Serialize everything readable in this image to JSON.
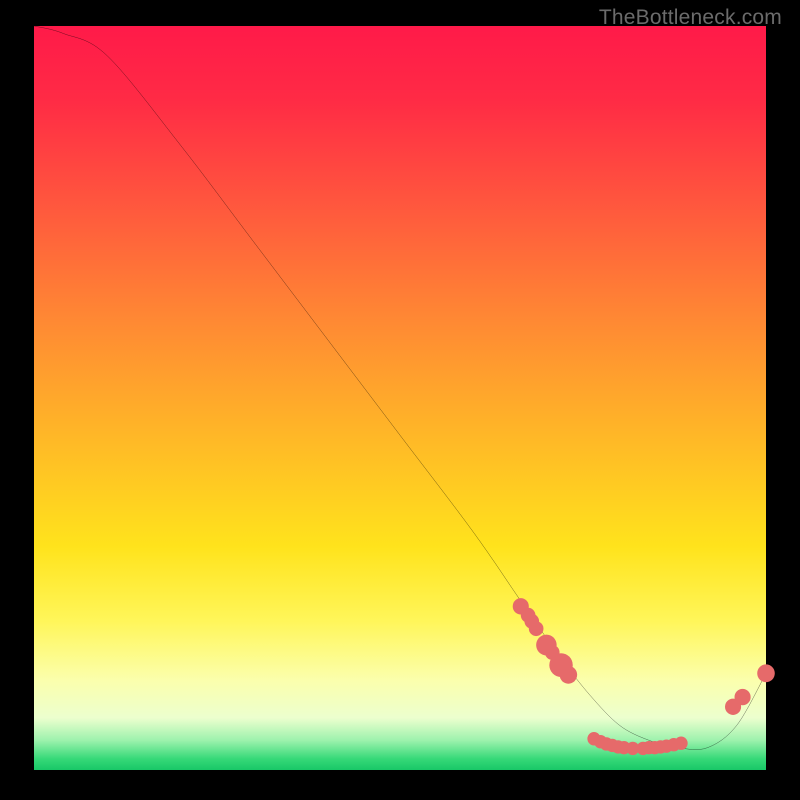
{
  "watermark": "TheBottleneck.com",
  "chart_data": {
    "type": "line",
    "title": "",
    "xlabel": "",
    "ylabel": "",
    "xlim": [
      0,
      100
    ],
    "ylim": [
      0,
      100
    ],
    "grid": false,
    "series": [
      {
        "name": "curve",
        "x": [
          0,
          4,
          10,
          20,
          30,
          40,
          50,
          60,
          67,
          72,
          76,
          80,
          84,
          88,
          92,
          96,
          100
        ],
        "y": [
          100,
          99,
          96,
          84,
          71,
          58,
          45,
          32,
          22,
          15,
          10,
          6,
          4,
          3,
          3,
          6,
          13
        ]
      }
    ],
    "markers": [
      {
        "x": 66.5,
        "y": 22.0,
        "r": 1.1
      },
      {
        "x": 67.5,
        "y": 20.8,
        "r": 1.0
      },
      {
        "x": 68.0,
        "y": 20.0,
        "r": 1.0
      },
      {
        "x": 68.6,
        "y": 19.0,
        "r": 1.0
      },
      {
        "x": 70.0,
        "y": 16.8,
        "r": 1.4
      },
      {
        "x": 70.8,
        "y": 15.8,
        "r": 1.0
      },
      {
        "x": 72.0,
        "y": 14.1,
        "r": 1.6
      },
      {
        "x": 73.0,
        "y": 12.8,
        "r": 1.2
      },
      {
        "x": 76.5,
        "y": 4.2,
        "r": 0.9
      },
      {
        "x": 77.4,
        "y": 3.8,
        "r": 0.9
      },
      {
        "x": 78.2,
        "y": 3.5,
        "r": 0.9
      },
      {
        "x": 79.0,
        "y": 3.3,
        "r": 0.9
      },
      {
        "x": 79.8,
        "y": 3.1,
        "r": 0.9
      },
      {
        "x": 80.6,
        "y": 3.0,
        "r": 0.9
      },
      {
        "x": 81.8,
        "y": 2.9,
        "r": 0.9
      },
      {
        "x": 83.2,
        "y": 2.9,
        "r": 0.9
      },
      {
        "x": 84.0,
        "y": 3.0,
        "r": 0.9
      },
      {
        "x": 84.8,
        "y": 3.0,
        "r": 0.9
      },
      {
        "x": 85.6,
        "y": 3.1,
        "r": 0.9
      },
      {
        "x": 86.4,
        "y": 3.2,
        "r": 0.9
      },
      {
        "x": 87.4,
        "y": 3.4,
        "r": 0.9
      },
      {
        "x": 88.4,
        "y": 3.6,
        "r": 0.9
      },
      {
        "x": 95.5,
        "y": 8.5,
        "r": 1.1
      },
      {
        "x": 96.8,
        "y": 9.8,
        "r": 1.1
      },
      {
        "x": 100.0,
        "y": 13.0,
        "r": 1.2
      }
    ],
    "colors": {
      "line": "#000000",
      "marker": "#e66a6a"
    }
  }
}
